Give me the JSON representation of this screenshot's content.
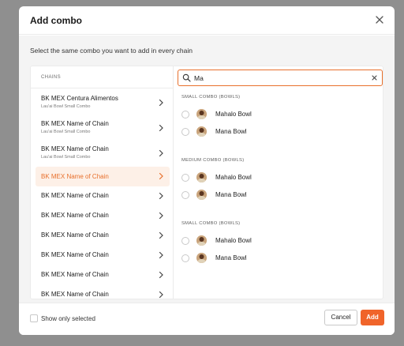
{
  "modal": {
    "title": "Add combo",
    "subtitle": "Select the same combo you want to add in every chain"
  },
  "chains": {
    "header": "CHAINS",
    "items": [
      {
        "name": "BK MEX Centura Alimentos",
        "sub": "Lau'ai Bowl Small Combo",
        "active": false
      },
      {
        "name": "BK MEX Name of Chain",
        "sub": "Lau'ai Bowl Small Combo",
        "active": false
      },
      {
        "name": "BK MEX Name of Chain",
        "sub": "Lau'ai Bowl Small Combo",
        "active": false
      },
      {
        "name": "BK MEX Name of Chain",
        "sub": "",
        "active": true
      },
      {
        "name": "BK MEX Name of Chain",
        "sub": "",
        "active": false
      },
      {
        "name": "BK MEX Name of Chain",
        "sub": "",
        "active": false
      },
      {
        "name": "BK MEX Name of Chain",
        "sub": "",
        "active": false
      },
      {
        "name": "BK MEX Name of Chain",
        "sub": "",
        "active": false
      },
      {
        "name": "BK MEX Name of Chain",
        "sub": "",
        "active": false
      },
      {
        "name": "BK MEX Name of Chain",
        "sub": "",
        "active": false
      }
    ]
  },
  "search": {
    "value": "Ma",
    "placeholder": ""
  },
  "groups": [
    {
      "title": "SMALL COMBO (BOWLS)",
      "options": [
        "Mahalo Bowl",
        "Mana Bowl"
      ]
    },
    {
      "title": "MEDIUM COMBO (BOWLS)",
      "options": [
        "Mahalo Bowl",
        "Mana Bowl"
      ]
    },
    {
      "title": "SMALL COMBO (BOWLS)",
      "options": [
        "Mahalo Bowl",
        "Mana Bowl"
      ]
    }
  ],
  "footer": {
    "show_only_selected": "Show only selected",
    "cancel": "Cancel",
    "add": "Add"
  },
  "colors": {
    "accent": "#f0642a",
    "active_bg": "#fdf0e7",
    "overlay": "#8f8f8f"
  },
  "icons": {
    "close": "close-icon",
    "search": "search-icon",
    "clear": "clear-icon",
    "chevron": "chevron-right-icon"
  }
}
